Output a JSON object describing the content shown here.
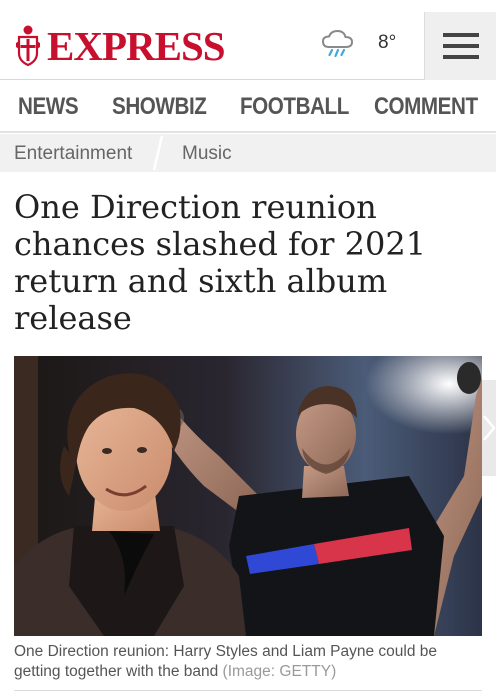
{
  "header": {
    "logo_text": "EXPRESS",
    "brand_color": "#c8102e",
    "weather_icon": "rain-cloud-icon",
    "temperature": "8°",
    "menu_icon": "hamburger-menu-icon"
  },
  "nav": {
    "items": [
      {
        "label": "NEWS"
      },
      {
        "label": "SHOWBIZ"
      },
      {
        "label": "FOOTBALL"
      },
      {
        "label": "COMMENT"
      }
    ]
  },
  "breadcrumb": {
    "items": [
      {
        "label": "Entertainment"
      },
      {
        "label": "Music"
      }
    ]
  },
  "article": {
    "headline": "One Direction reunion chances slashed for 2021 return and sixth album release",
    "image": {
      "caption": "One Direction reunion: Harry Styles and Liam Payne could be getting together with the band",
      "credit": "(Image: GETTY)",
      "next_icon": "chevron-right-icon"
    }
  }
}
